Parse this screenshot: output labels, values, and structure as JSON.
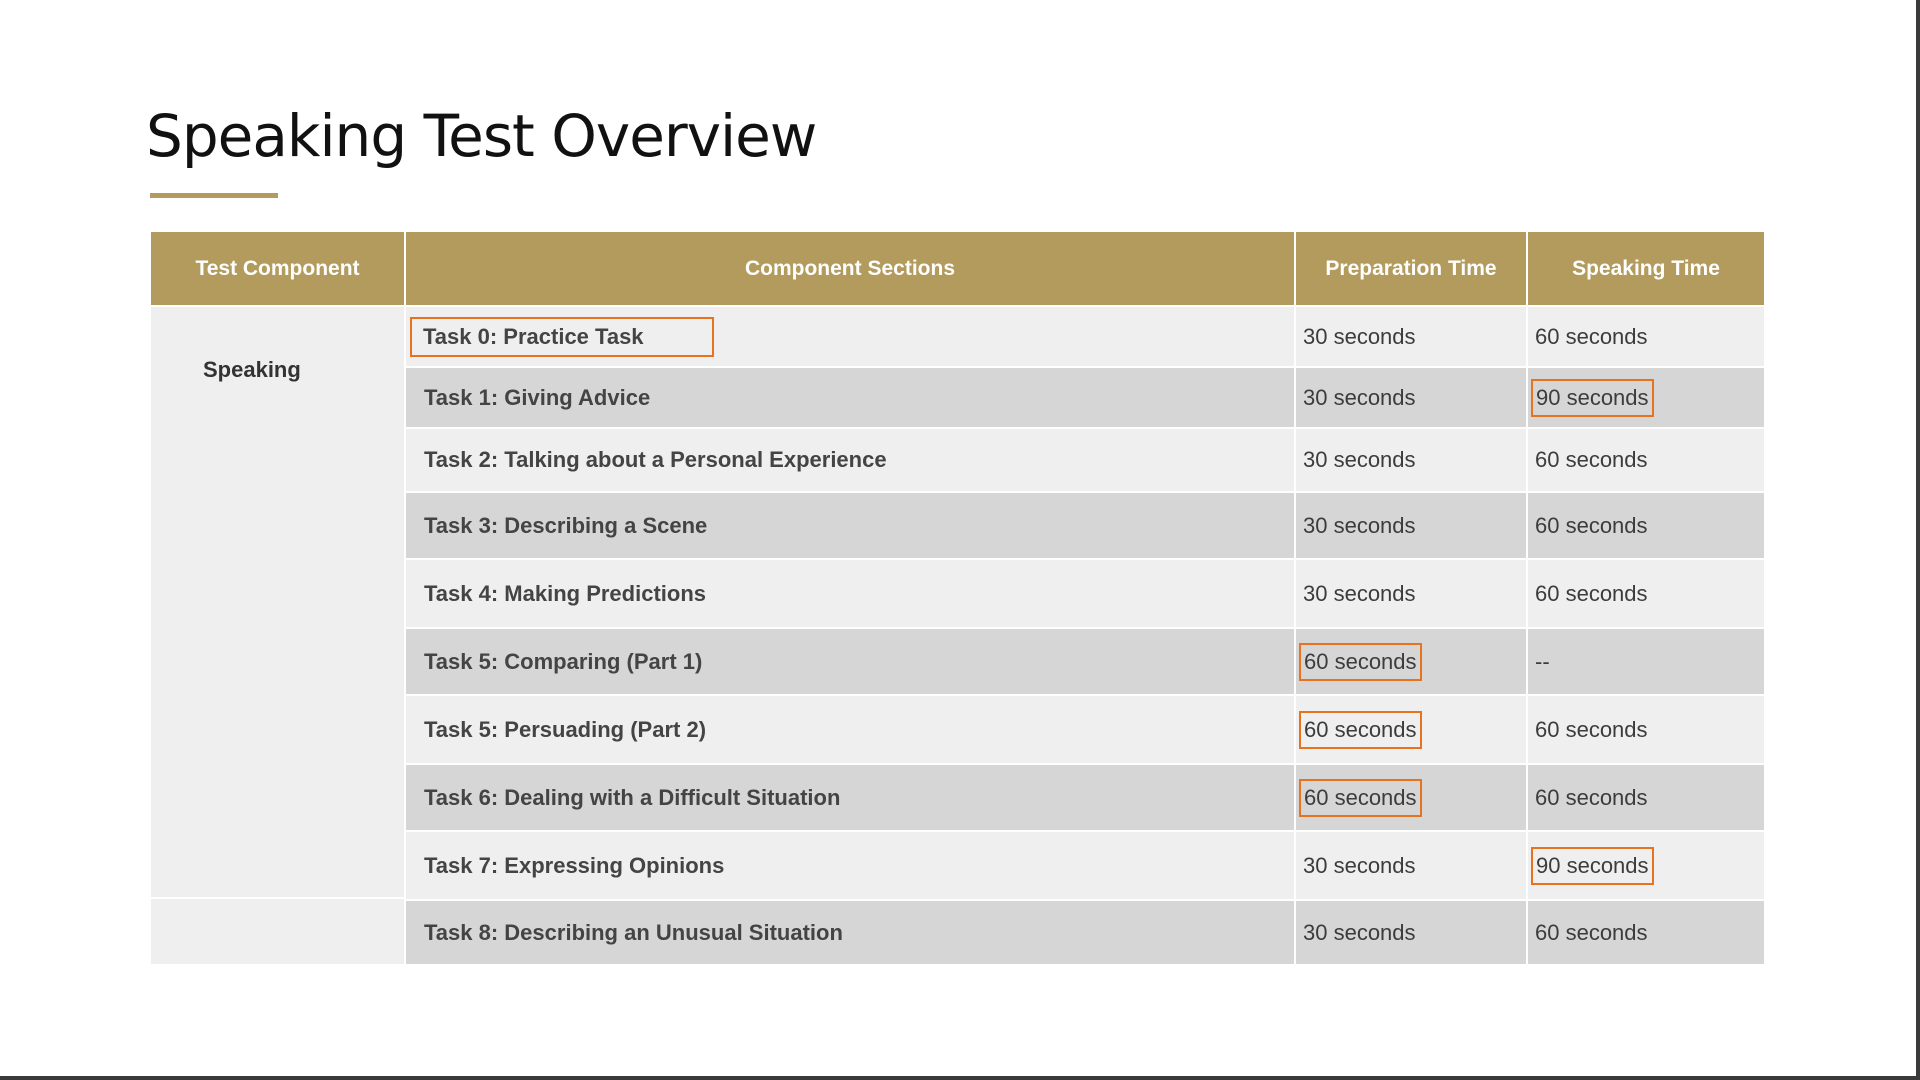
{
  "title": "Speaking Test Overview",
  "accent_color": "#b39b5e",
  "highlight_color": "#e8731f",
  "table": {
    "headers": [
      "Test Component",
      "Component Sections",
      "Preparation Time",
      "Speaking Time"
    ],
    "component": "Speaking",
    "rows": [
      {
        "section": "Task 0: Practice Task",
        "prep": "30 seconds",
        "speak": "60 seconds"
      },
      {
        "section": "Task 1: Giving Advice",
        "prep": "30 seconds",
        "speak": "90 seconds"
      },
      {
        "section": "Task 2: Talking about a Personal Experience",
        "prep": "30 seconds",
        "speak": "60 seconds"
      },
      {
        "section": "Task 3: Describing a Scene",
        "prep": "30 seconds",
        "speak": "60 seconds"
      },
      {
        "section": "Task 4: Making Predictions",
        "prep": "30 seconds",
        "speak": "60 seconds"
      },
      {
        "section": "Task 5: Comparing (Part 1)",
        "prep": "60 seconds",
        "speak": "--"
      },
      {
        "section": "Task 5: Persuading (Part 2)",
        "prep": "60 seconds",
        "speak": "60 seconds"
      },
      {
        "section": "Task 6: Dealing with a Difficult Situation",
        "prep": "60 seconds",
        "speak": "60 seconds"
      },
      {
        "section": "Task 7: Expressing Opinions",
        "prep": "30 seconds",
        "speak": "90 seconds"
      },
      {
        "section": "Task 8: Describing an Unusual Situation",
        "prep": "30 seconds",
        "speak": "60 seconds"
      }
    ]
  }
}
